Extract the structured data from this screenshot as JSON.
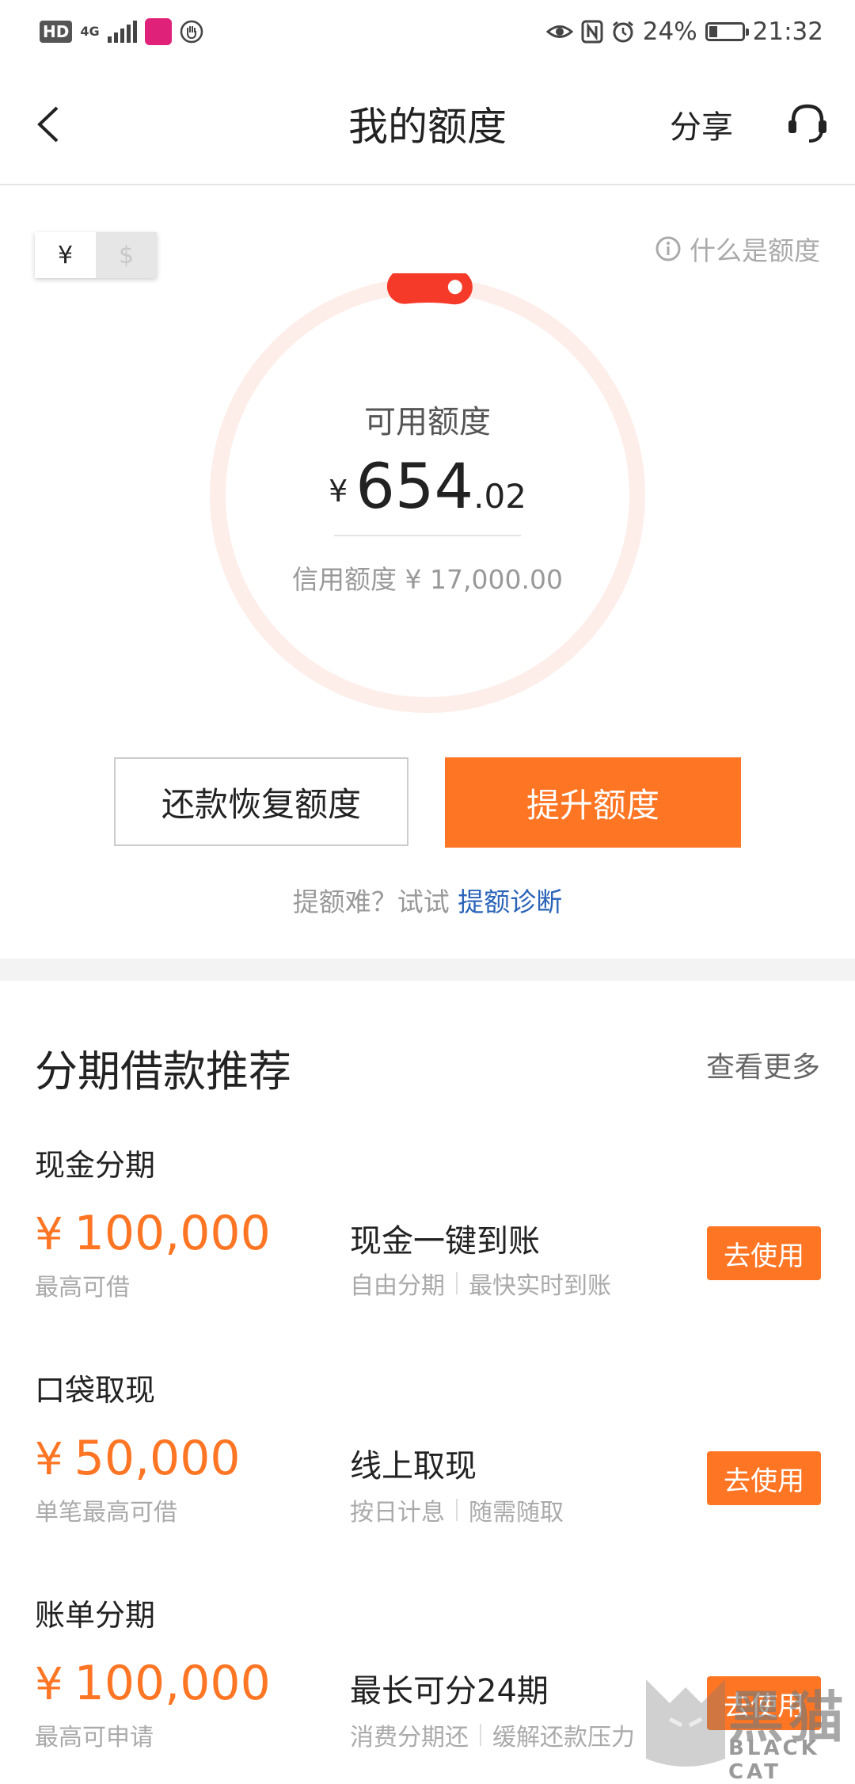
{
  "status_bar": {
    "hd": "HD",
    "network": "4G",
    "battery_percent": "24%",
    "battery_level": 0.24,
    "time": "21:32"
  },
  "header": {
    "title": "我的额度",
    "share": "分享"
  },
  "currency_toggle": {
    "yen": "¥",
    "usd": "$",
    "selected": "¥"
  },
  "what_is": "什么是额度",
  "quota": {
    "label": "可用额度",
    "currency": "¥",
    "integer": "654",
    "decimal": ".02",
    "credit_line": "信用额度 ¥ 17,000.00",
    "available_fraction": 0.0385
  },
  "buttons": {
    "repay": "还款恢复额度",
    "raise": "提升额度"
  },
  "hint": {
    "text": "提额难？试试 ",
    "link": "提额诊断"
  },
  "section": {
    "title": "分期借款推荐",
    "more": "查看更多"
  },
  "products": [
    {
      "name": "现金分期",
      "amount": "100,000",
      "currency": "¥",
      "amount_sub": "最高可借",
      "headline": "现金一键到账",
      "tags": [
        "自由分期",
        "最快实时到账"
      ],
      "button": "去使用"
    },
    {
      "name": "口袋取现",
      "amount": "50,000",
      "currency": "¥",
      "amount_sub": "单笔最高可借",
      "headline": "线上取现",
      "tags": [
        "按日计息",
        "随需随取"
      ],
      "button": "去使用"
    },
    {
      "name": "账单分期",
      "amount": "100,000",
      "currency": "¥",
      "amount_sub": "最高可申请",
      "headline": "最长可分24期",
      "tags": [
        "消费分期还",
        "缓解还款压力"
      ],
      "button": "去使用"
    }
  ],
  "watermark": {
    "cn": "黑猫",
    "en": "BLACK CAT"
  },
  "colors": {
    "accent": "#fe7524",
    "ring_track": "#fdeeea",
    "ring_progress": "#f63a2a",
    "link": "#2a63b8"
  }
}
